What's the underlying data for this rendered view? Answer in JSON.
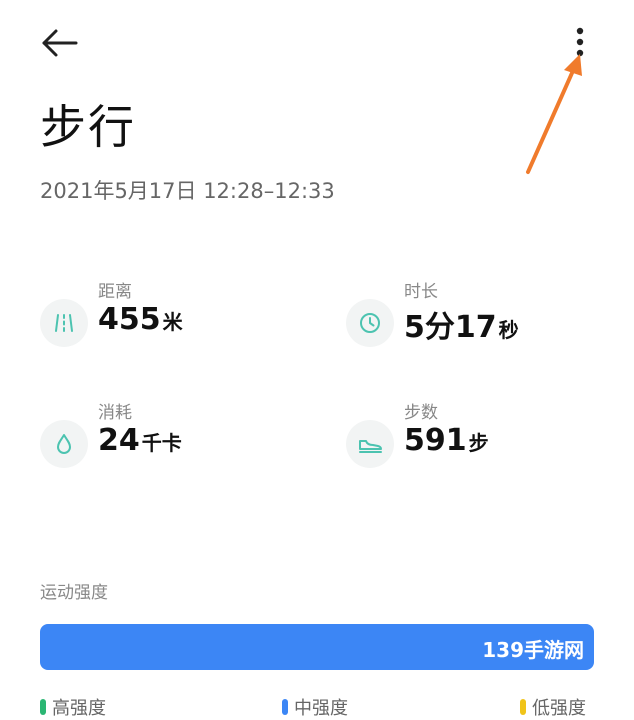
{
  "header": {
    "back_icon": "arrow-left-icon",
    "menu_icon": "more-vertical-icon"
  },
  "title": "步行",
  "datetime": "2021年5月17日 12:28–12:33",
  "stats": {
    "distance": {
      "label": "距离",
      "value": "455",
      "unit": "米",
      "icon": "distance-icon"
    },
    "duration": {
      "label": "时长",
      "value": "5分17",
      "unit": "秒",
      "icon": "clock-icon"
    },
    "calories": {
      "label": "消耗",
      "value": "24",
      "unit": "千卡",
      "icon": "flame-icon"
    },
    "steps": {
      "label": "步数",
      "value": "591",
      "unit": "步",
      "icon": "shoe-icon"
    }
  },
  "intensity": {
    "label": "运动强度",
    "watermark": "139手游网",
    "bar_color": "#3c86f5",
    "legend": [
      {
        "label": "高强度",
        "color": "#2bb673"
      },
      {
        "label": "中强度",
        "color": "#3c86f5"
      },
      {
        "label": "低强度",
        "color": "#f0c419"
      }
    ]
  },
  "colors": {
    "accent": "#4cc3b0",
    "annotation_arrow": "#f07b2c"
  }
}
